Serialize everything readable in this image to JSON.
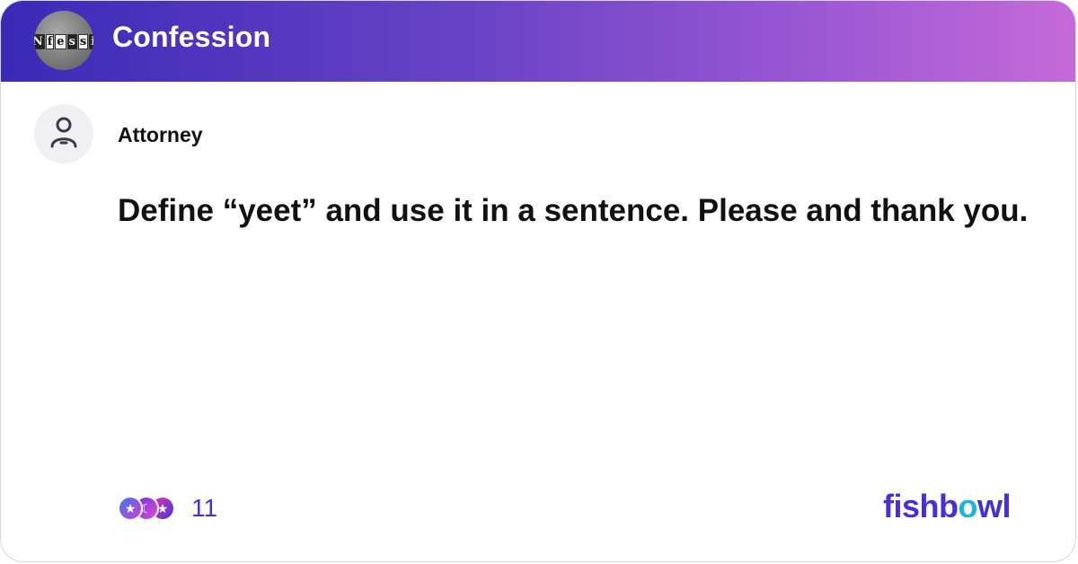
{
  "header": {
    "title": "Confession",
    "group_avatar_letters": [
      "N",
      "f",
      "e",
      "s",
      "s",
      "i"
    ]
  },
  "post": {
    "author": "Attorney",
    "text": "Define “yeet” and use it in a sentence. Please and thank you."
  },
  "reactions": {
    "count": "11",
    "icons": [
      "star-reaction-icon",
      "moon-reaction-icon",
      "star-reaction-icon"
    ]
  },
  "brand": {
    "before_o": "fishb",
    "o": "o",
    "after_o": "wl"
  },
  "colors": {
    "header_gradient_start": "#3a2ab7",
    "header_gradient_end": "#c56ad8",
    "brand_primary": "#4a2fd6",
    "brand_accent": "#19b8d8"
  }
}
